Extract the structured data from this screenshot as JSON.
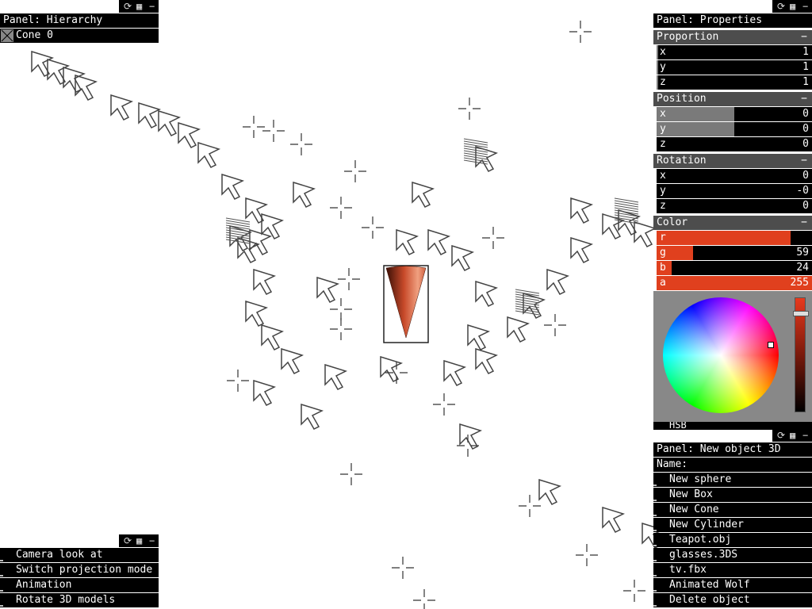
{
  "hierarchy": {
    "panel_title": "Panel: Hierarchy",
    "items": [
      {
        "label": "Cone 0"
      }
    ]
  },
  "properties": {
    "panel_title": "Panel: Properties",
    "proportion": {
      "title": "Proportion",
      "collapse": "−",
      "x": "1",
      "y": "1",
      "z": "1"
    },
    "position": {
      "title": "Position",
      "collapse": "−",
      "x": "0",
      "y": "0",
      "z": "0"
    },
    "rotation": {
      "title": "Rotation",
      "collapse": "−",
      "x": "0",
      "y": "-0",
      "z": "0"
    },
    "color": {
      "title": "Color",
      "collapse": "−",
      "r_label": "r",
      "g_label": "g",
      "b_label": "b",
      "a_label": "a",
      "r": "",
      "g": "59",
      "b": "24",
      "a": "255",
      "swatch": "#e0401e",
      "mode_label": "HSB"
    }
  },
  "new_object_panel": {
    "panel_title": "Panel: New object 3D",
    "name_label": "Name:",
    "items": [
      "New sphere",
      "New Box",
      "New Cone",
      "New Cylinder",
      "Teapot.obj",
      "glasses.3DS",
      "tv.fbx",
      "Animated Wolf",
      "Delete object"
    ]
  },
  "actions_panel": {
    "items": [
      "Camera look at",
      "Switch projection mode",
      "Animation",
      "Rotate 3D models"
    ]
  },
  "window_controls": {
    "refresh": "⟳",
    "save": "▦",
    "minimize": "−"
  },
  "scene": {
    "selected_object": "Cone 0",
    "object_color": "#e0401e"
  }
}
